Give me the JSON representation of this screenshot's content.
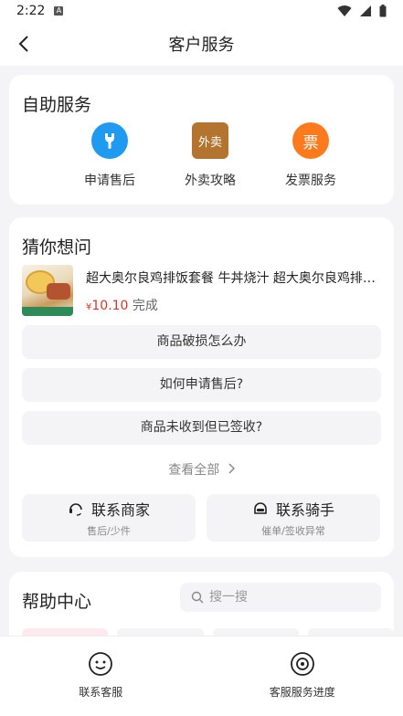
{
  "status_bar": {
    "time": "2:22",
    "notif_icon": "A"
  },
  "nav": {
    "title": "客户服务"
  },
  "self_service": {
    "title": "自助服务",
    "items": [
      {
        "label": "申请售后",
        "icon": "wrench-icon",
        "color": "#1e9bf0"
      },
      {
        "label": "外卖攻略",
        "icon": "takeout-box-icon",
        "icon_text": "外卖",
        "color": "#b3742f"
      },
      {
        "label": "发票服务",
        "icon": "invoice-icon",
        "icon_text": "票",
        "color": "#ff7a1c"
      }
    ]
  },
  "guess": {
    "title": "猜你想问",
    "order": {
      "name": "超大奥尔良鸡排饭套餐 牛丼烧汁 超大奥尔良鸡排…",
      "currency": "¥",
      "price": "10.10",
      "status": "完成"
    },
    "faqs": [
      "商品破损怎么办",
      "如何申请售后?",
      "商品未收到但已签收?"
    ],
    "see_all": "查看全部",
    "contacts": [
      {
        "title": "联系商家",
        "sub": "售后/少件",
        "icon": "headset-icon"
      },
      {
        "title": "联系骑手",
        "sub": "催单/签收异常",
        "icon": "helmet-icon"
      }
    ]
  },
  "help": {
    "title": "帮助中心",
    "search_placeholder": "搜一搜"
  },
  "bottom_tabs": [
    {
      "label": "联系客服",
      "icon": "smiley-icon"
    },
    {
      "label": "客服服务进度",
      "icon": "progress-target-icon"
    }
  ],
  "colors": {
    "price": "#e0322b",
    "accent_blue": "#1e9bf0",
    "accent_orange": "#ff7a1c"
  }
}
